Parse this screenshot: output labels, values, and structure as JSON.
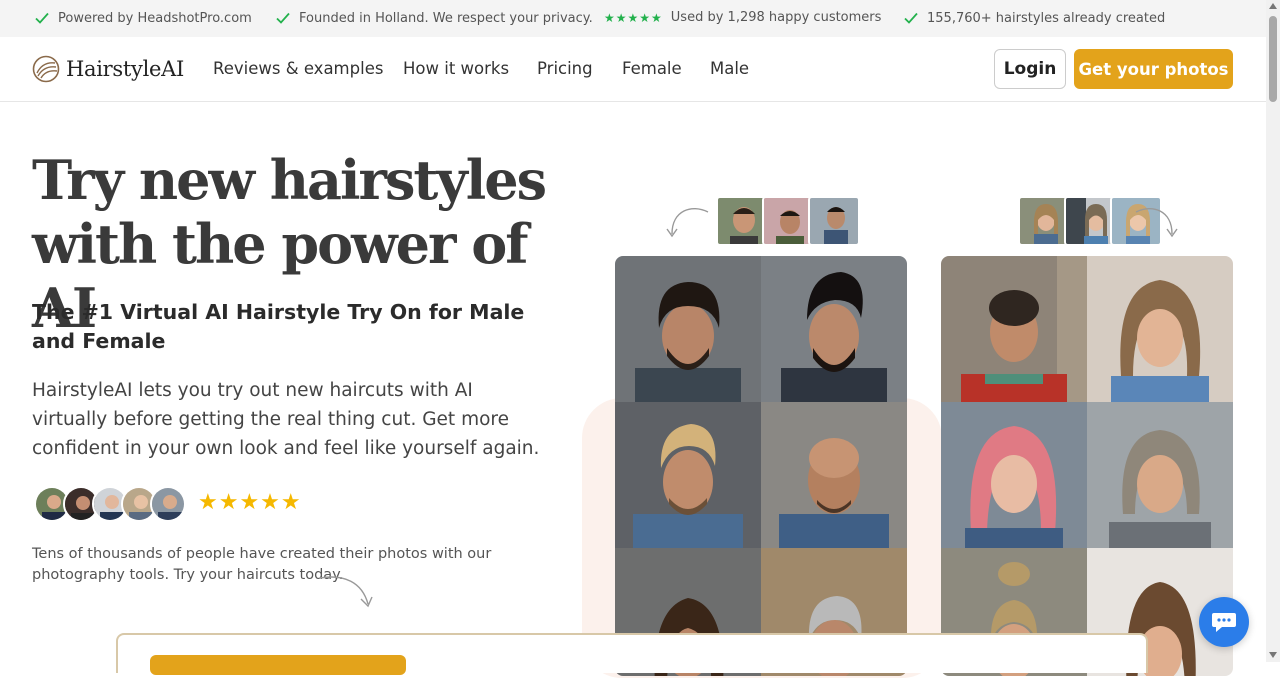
{
  "trust_bar": {
    "items": [
      "Powered by HeadshotPro.com",
      "Founded in Holland. We respect your privacy.",
      "Used by 1,298 happy customers",
      "155,760+ hairstyles already created"
    ],
    "stars": "★★★★★"
  },
  "nav": {
    "logo_text": "HairstyleAI",
    "links": [
      "Reviews & examples",
      "How it works",
      "Pricing",
      "Female",
      "Male"
    ],
    "login_label": "Login",
    "cta_label": "Get your photos"
  },
  "hero": {
    "title_line1": "Try new hairstyles",
    "title_line2": "with the power of AI",
    "subtitle": "The #1 Virtual AI Hairstyle Try On for Male and Female",
    "description": "HairstyleAI lets you try out new haircuts with AI virtually before getting the real thing cut. Get more confident in your own look and feel like yourself again.",
    "rating_stars": "★★★★★",
    "small_text": "Tens of thousands of people have created their photos with our photography tools. Try your haircuts today."
  },
  "colors": {
    "accent": "#e3a31b",
    "check_green": "#22b14c",
    "star_yellow": "#f5b800",
    "chat_blue": "#2b7de9"
  },
  "icons": {
    "check": "check-icon",
    "chat": "chat-icon",
    "logo": "hairstyle-logo-icon"
  }
}
